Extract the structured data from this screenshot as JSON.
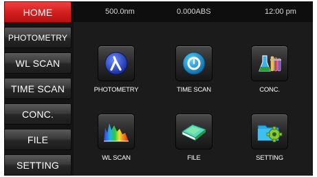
{
  "sidebar": {
    "items": [
      {
        "label": "HOME"
      },
      {
        "label": "PHOTOMETRY"
      },
      {
        "label": "WL SCAN"
      },
      {
        "label": "TIME SCAN"
      },
      {
        "label": "CONC."
      },
      {
        "label": "FILE"
      },
      {
        "label": "SETTING"
      }
    ],
    "active_index": 0
  },
  "status": {
    "wavelength": "500.0nm",
    "absorbance": "0.000ABS",
    "time": "12:00 pm"
  },
  "tiles": [
    {
      "label": "PHOTOMETRY",
      "icon": "lambda-icon"
    },
    {
      "label": "TIME SCAN",
      "icon": "timer-icon"
    },
    {
      "label": "CONC.",
      "icon": "flask-icon"
    },
    {
      "label": "WL SCAN",
      "icon": "spectrum-icon"
    },
    {
      "label": "FILE",
      "icon": "book-icon"
    },
    {
      "label": "SETTING",
      "icon": "gear-folder-icon"
    }
  ],
  "colors": {
    "active": "#d42020",
    "background": "#1b1b1b",
    "button": "#2c2c2c"
  }
}
